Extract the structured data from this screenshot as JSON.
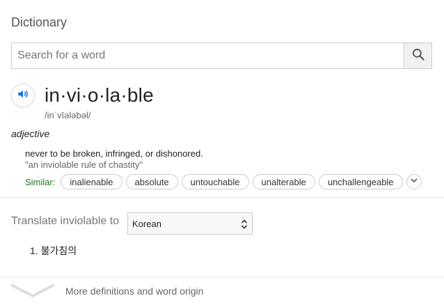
{
  "header": {
    "title": "Dictionary"
  },
  "search": {
    "placeholder": "Search for a word",
    "value": ""
  },
  "entry": {
    "headword": "in·vi·o·la·ble",
    "phonetic": "/inˈvīələbəl/",
    "part_of_speech": "adjective",
    "definition": "never to be broken, infringed, or dishonored.",
    "example": "\"an inviolable rule of chastity\"",
    "similar_label": "Similar:",
    "similar": [
      "inalienable",
      "absolute",
      "untouchable",
      "unalterable",
      "unchallengeable"
    ]
  },
  "translate": {
    "label": "Translate inviolable to",
    "selected_language": "Korean",
    "results": [
      "1. 불가침의"
    ]
  },
  "footer": {
    "more_label": "More definitions and word origin"
  },
  "colors": {
    "similar_label": "#1a7a1a",
    "speaker_icon": "#1a73e8",
    "text": "#222222",
    "muted": "#666666"
  },
  "icons": {
    "search": "search-icon",
    "speaker": "speaker-icon",
    "expand": "chevron-down-icon",
    "select": "select-arrows-icon",
    "more": "chevron-down-icon"
  }
}
